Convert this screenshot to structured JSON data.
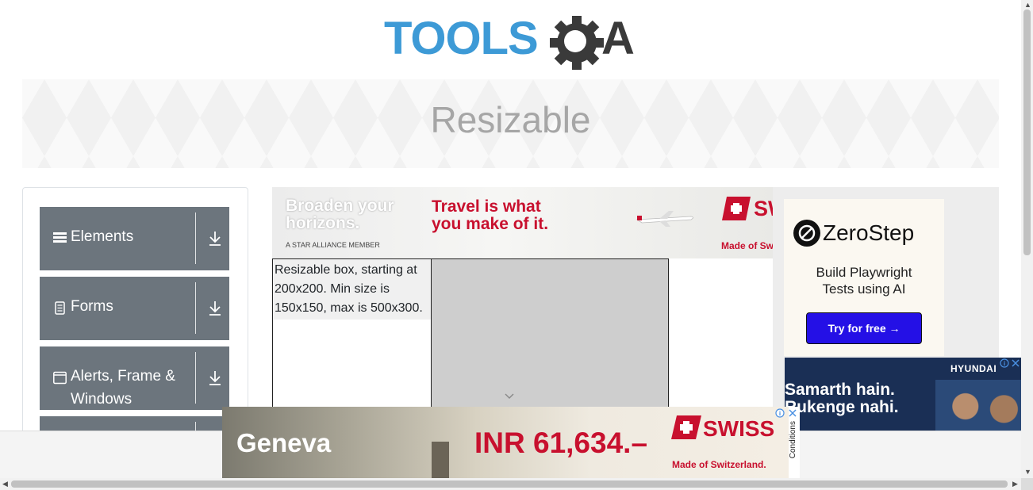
{
  "header": {
    "logo_text_left": "TOOLS",
    "logo_text_right": "QA"
  },
  "banner": {
    "title": "Resizable"
  },
  "sidebar": {
    "groups": [
      {
        "label": "Elements",
        "icon": "hamburger-icon"
      },
      {
        "label": "Forms",
        "icon": "document-icon"
      },
      {
        "label": "Alerts, Frame & Windows",
        "icon": "window-icon"
      }
    ]
  },
  "resizable": {
    "box_text": "Resizable box, starting at 200x200. Min size is 150x150, max is 500x300."
  },
  "ads": {
    "top": {
      "headline": "Broaden your horizons.",
      "member": "A STAR ALLIANCE MEMBER",
      "tagline": "Travel is what you make of it.",
      "made": "Made of Sw"
    },
    "zerostep": {
      "brand": "ZeroStep",
      "blurb": "Build Playwright Tests using AI",
      "button": "Try for free →"
    },
    "hyundai": {
      "brand": "HYUNDAI",
      "headline": "Samarth hain. Rukenge nahi."
    },
    "bottom": {
      "city": "Geneva",
      "price": "INR 61,634.–",
      "brand": "SWISS",
      "made": "Made of Switzerland.",
      "conditions": "Conditions"
    }
  },
  "colors": {
    "accent_blue": "#3d9ad6",
    "logo_dark": "#3a3a3a",
    "sidebar_group": "#6c757d",
    "swiss_red": "#c8102e",
    "zerostep_button": "#2410e6"
  }
}
